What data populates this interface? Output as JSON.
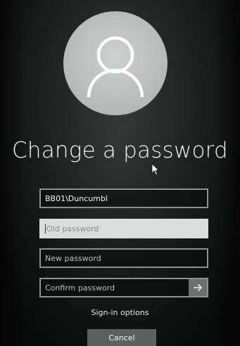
{
  "title": "Change a password",
  "avatar": {
    "icon": "user-icon"
  },
  "fields": {
    "username": {
      "value": "BB01\\Duncumbl"
    },
    "old_password": {
      "placeholder": "Old password"
    },
    "new_password": {
      "placeholder": "New password"
    },
    "confirm_password": {
      "placeholder": "Confirm password",
      "submit_icon": "arrow-right-icon"
    }
  },
  "links": {
    "sign_in_options": "Sign-in options"
  },
  "buttons": {
    "cancel": "Cancel"
  },
  "colors": {
    "field_border": "#8f9190",
    "active_field_bg": "#d9dcdb",
    "button_bg": "#5e605f",
    "text": "#f2f2f2"
  }
}
